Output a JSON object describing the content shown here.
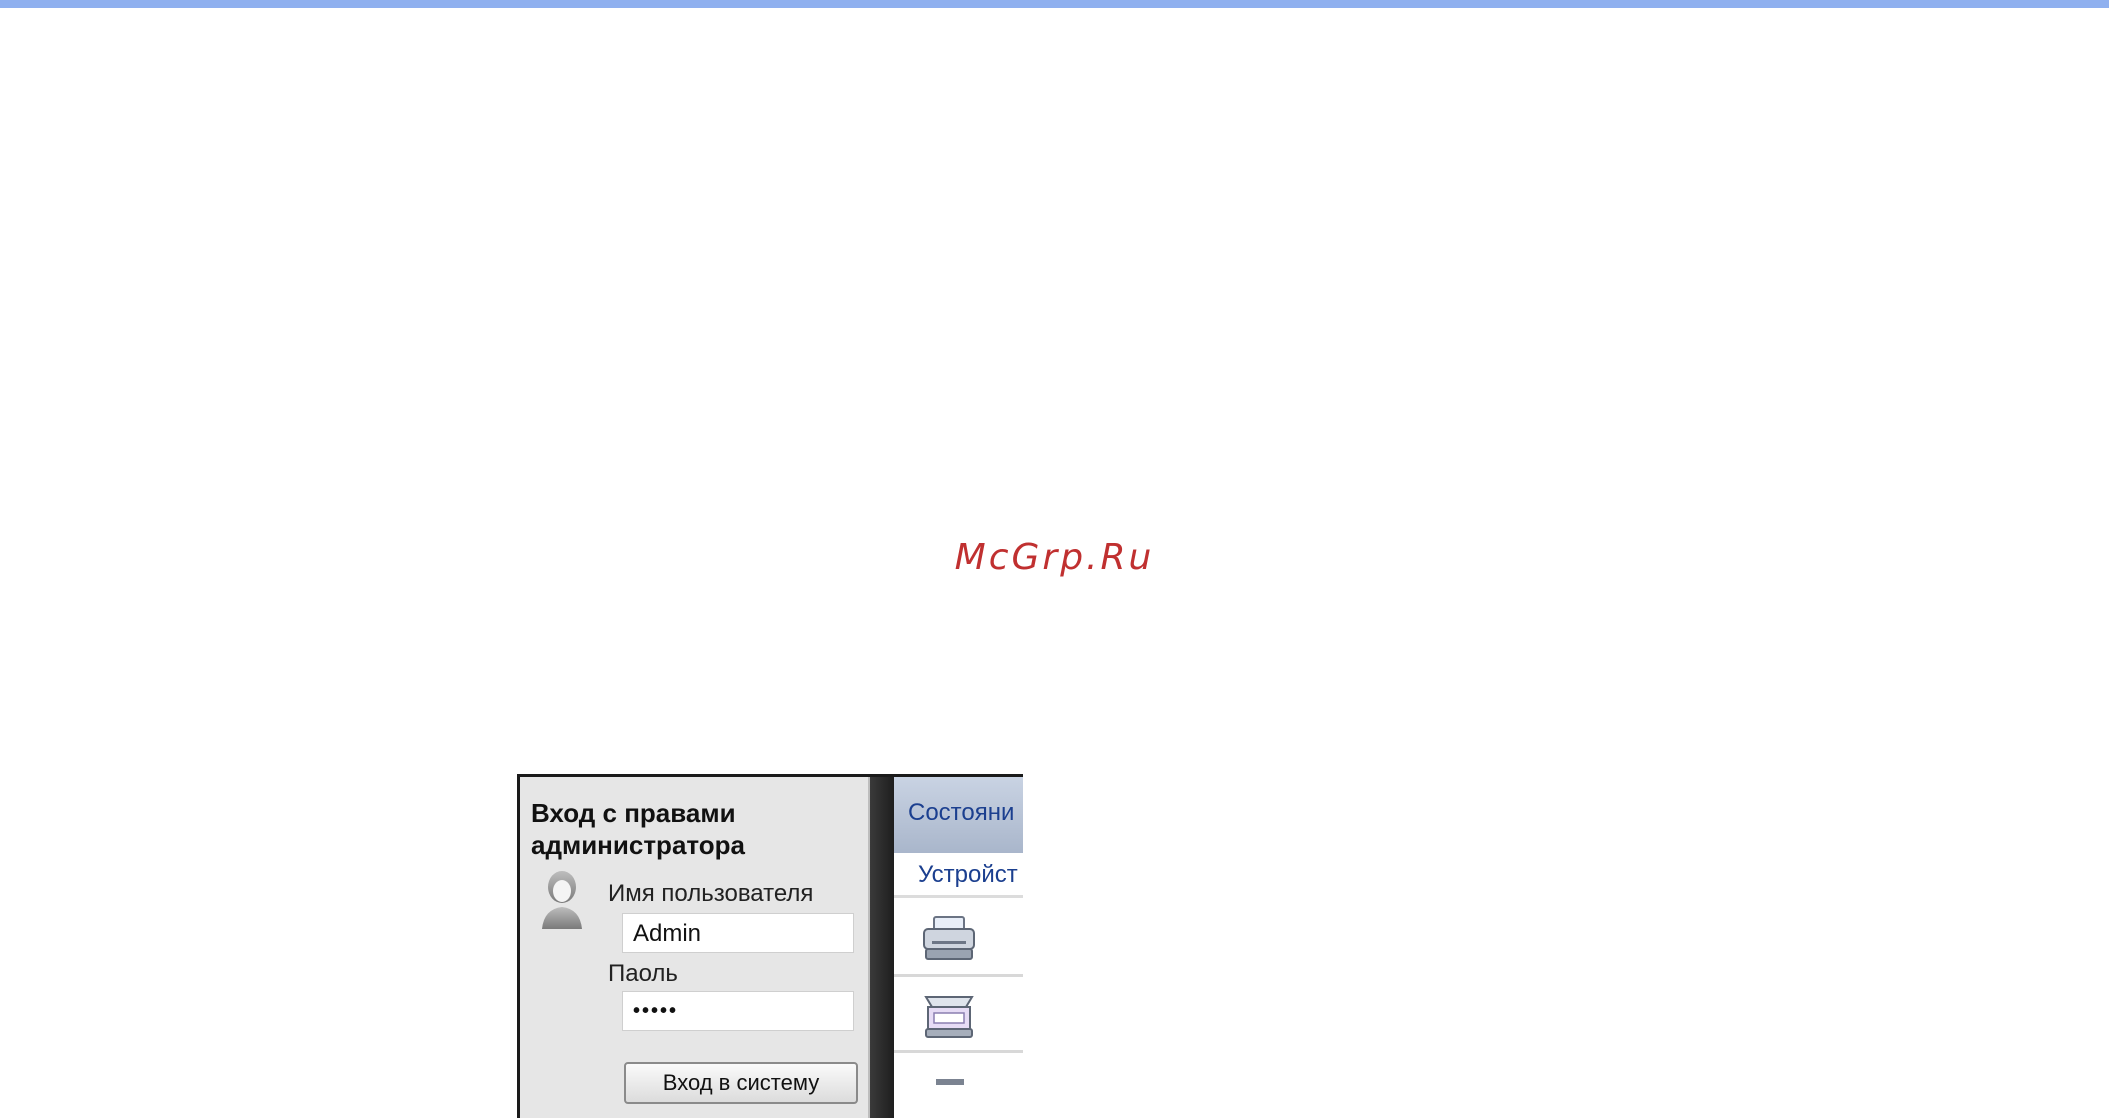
{
  "watermark": "McGrp.Ru",
  "login": {
    "title": "Вход с правами администратора",
    "username_label": "Имя пользователя",
    "username_value": "Admin",
    "password_label": "Паоль",
    "password_value": "•••••",
    "submit_label": "Вход в систему"
  },
  "right_pane": {
    "tab_label": "Состояни",
    "sub_label": "Устройст",
    "icons": [
      "printer-icon",
      "scanner-icon",
      "device-icon"
    ]
  },
  "colors": {
    "top_rule": "#8fb0ef",
    "watermark": "#c03030",
    "link_blue": "#1b3f8f"
  }
}
